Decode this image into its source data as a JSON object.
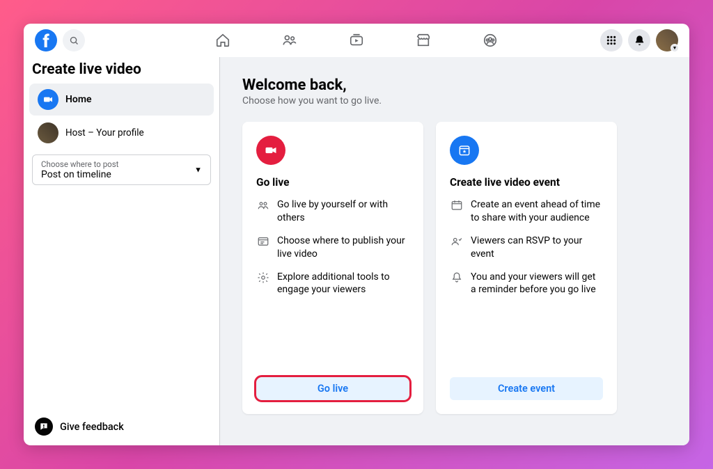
{
  "sidebar": {
    "title": "Create live video",
    "home_label": "Home",
    "host_label": "Host – Your profile",
    "post_select": {
      "label": "Choose where to post",
      "value": "Post on timeline"
    },
    "feedback_label": "Give feedback"
  },
  "main": {
    "welcome_title": "Welcome back,",
    "welcome_sub": "Choose how you want to go live."
  },
  "cards": {
    "go_live": {
      "title": "Go live",
      "feat1": "Go live by yourself or with others",
      "feat2": "Choose where to publish your live video",
      "feat3": "Explore additional tools to engage your viewers",
      "button": "Go live"
    },
    "create_event": {
      "title": "Create live video event",
      "feat1": "Create an event ahead of time to share with your audience",
      "feat2": "Viewers can RSVP to your event",
      "feat3": "You and your viewers will get a reminder before you go live",
      "button": "Create event"
    }
  }
}
